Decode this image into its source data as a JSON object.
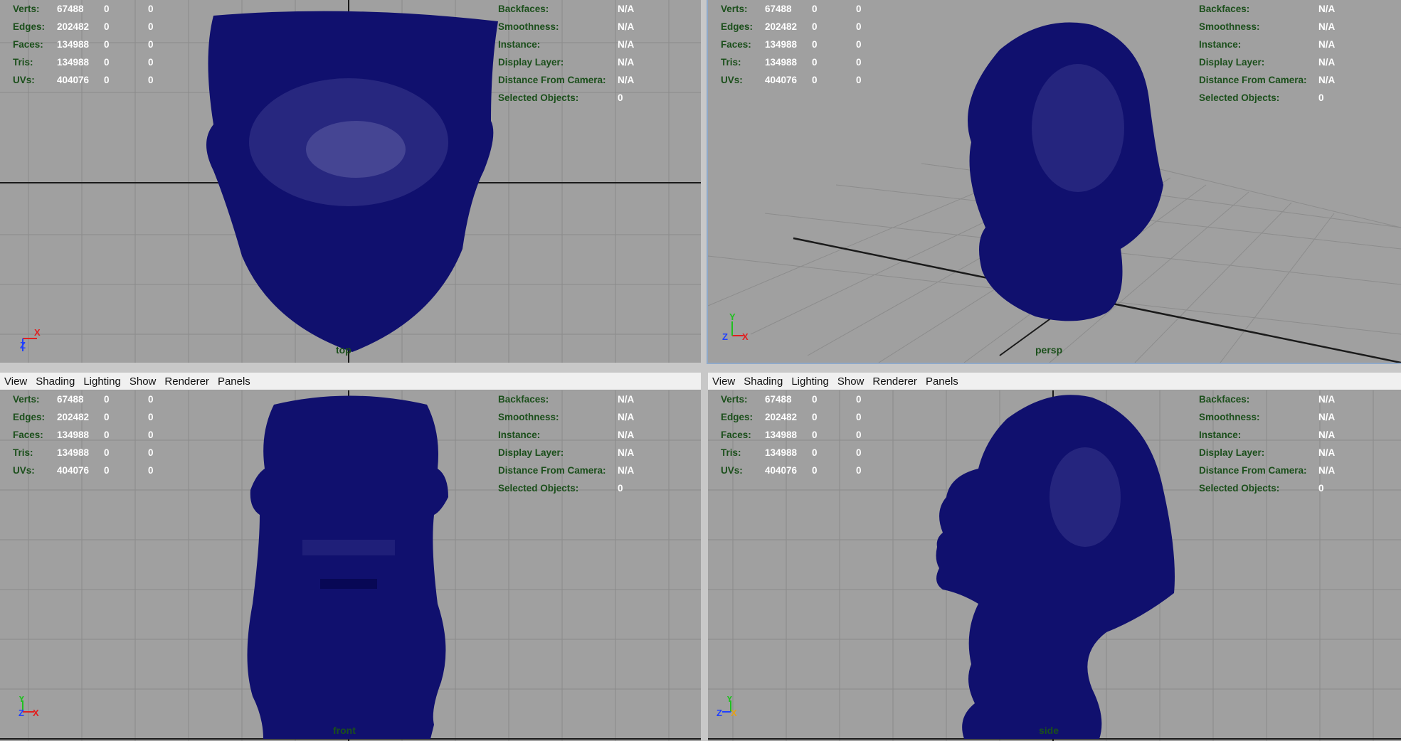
{
  "menu": [
    "View",
    "Shading",
    "Lighting",
    "Show",
    "Renderer",
    "Panels"
  ],
  "hud_left": [
    {
      "label": "Verts:",
      "v": "67488",
      "a": "0",
      "b": "0"
    },
    {
      "label": "Edges:",
      "v": "202482",
      "a": "0",
      "b": "0"
    },
    {
      "label": "Faces:",
      "v": "134988",
      "a": "0",
      "b": "0"
    },
    {
      "label": "Tris:",
      "v": "134988",
      "a": "0",
      "b": "0"
    },
    {
      "label": "UVs:",
      "v": "404076",
      "a": "0",
      "b": "0"
    }
  ],
  "hud_right": [
    {
      "label": "Backfaces:",
      "v": "N/A"
    },
    {
      "label": "Smoothness:",
      "v": "N/A"
    },
    {
      "label": "Instance:",
      "v": "N/A"
    },
    {
      "label": "Display Layer:",
      "v": "N/A"
    },
    {
      "label": "Distance From Camera:",
      "v": "N/A"
    },
    {
      "label": "Selected Objects:",
      "v": "0"
    }
  ],
  "viewports": {
    "top": {
      "camera": "top",
      "axes": [
        "Z",
        "X"
      ]
    },
    "persp": {
      "camera": "persp",
      "axes": [
        "Y",
        "Z",
        "X"
      ]
    },
    "front": {
      "camera": "front",
      "axes": [
        "Y",
        "Z",
        "X"
      ]
    },
    "side": {
      "camera": "side",
      "axes": [
        "Y",
        "Z",
        "X"
      ]
    }
  },
  "colors": {
    "mesh": "#10106e",
    "viewport_bg": "#a0a0a0",
    "grid": "#8a8a8a",
    "hud_label": "#1b4f1b",
    "hud_value": "#ffffff",
    "axis_x": "#e02020",
    "axis_y": "#20c020",
    "axis_z": "#2040ff"
  }
}
